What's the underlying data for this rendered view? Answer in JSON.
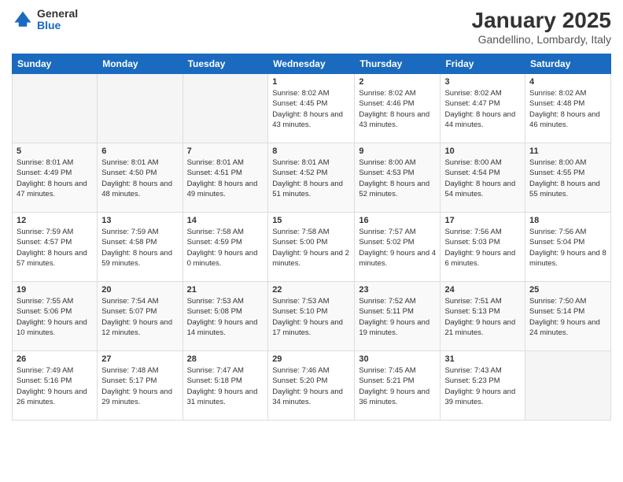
{
  "header": {
    "logo_general": "General",
    "logo_blue": "Blue",
    "month_title": "January 2025",
    "location": "Gandellino, Lombardy, Italy"
  },
  "days_of_week": [
    "Sunday",
    "Monday",
    "Tuesday",
    "Wednesday",
    "Thursday",
    "Friday",
    "Saturday"
  ],
  "weeks": [
    [
      {
        "day": "",
        "info": ""
      },
      {
        "day": "",
        "info": ""
      },
      {
        "day": "",
        "info": ""
      },
      {
        "day": "1",
        "info": "Sunrise: 8:02 AM\nSunset: 4:45 PM\nDaylight: 8 hours and 43 minutes."
      },
      {
        "day": "2",
        "info": "Sunrise: 8:02 AM\nSunset: 4:46 PM\nDaylight: 8 hours and 43 minutes."
      },
      {
        "day": "3",
        "info": "Sunrise: 8:02 AM\nSunset: 4:47 PM\nDaylight: 8 hours and 44 minutes."
      },
      {
        "day": "4",
        "info": "Sunrise: 8:02 AM\nSunset: 4:48 PM\nDaylight: 8 hours and 46 minutes."
      }
    ],
    [
      {
        "day": "5",
        "info": "Sunrise: 8:01 AM\nSunset: 4:49 PM\nDaylight: 8 hours and 47 minutes."
      },
      {
        "day": "6",
        "info": "Sunrise: 8:01 AM\nSunset: 4:50 PM\nDaylight: 8 hours and 48 minutes."
      },
      {
        "day": "7",
        "info": "Sunrise: 8:01 AM\nSunset: 4:51 PM\nDaylight: 8 hours and 49 minutes."
      },
      {
        "day": "8",
        "info": "Sunrise: 8:01 AM\nSunset: 4:52 PM\nDaylight: 8 hours and 51 minutes."
      },
      {
        "day": "9",
        "info": "Sunrise: 8:00 AM\nSunset: 4:53 PM\nDaylight: 8 hours and 52 minutes."
      },
      {
        "day": "10",
        "info": "Sunrise: 8:00 AM\nSunset: 4:54 PM\nDaylight: 8 hours and 54 minutes."
      },
      {
        "day": "11",
        "info": "Sunrise: 8:00 AM\nSunset: 4:55 PM\nDaylight: 8 hours and 55 minutes."
      }
    ],
    [
      {
        "day": "12",
        "info": "Sunrise: 7:59 AM\nSunset: 4:57 PM\nDaylight: 8 hours and 57 minutes."
      },
      {
        "day": "13",
        "info": "Sunrise: 7:59 AM\nSunset: 4:58 PM\nDaylight: 8 hours and 59 minutes."
      },
      {
        "day": "14",
        "info": "Sunrise: 7:58 AM\nSunset: 4:59 PM\nDaylight: 9 hours and 0 minutes."
      },
      {
        "day": "15",
        "info": "Sunrise: 7:58 AM\nSunset: 5:00 PM\nDaylight: 9 hours and 2 minutes."
      },
      {
        "day": "16",
        "info": "Sunrise: 7:57 AM\nSunset: 5:02 PM\nDaylight: 9 hours and 4 minutes."
      },
      {
        "day": "17",
        "info": "Sunrise: 7:56 AM\nSunset: 5:03 PM\nDaylight: 9 hours and 6 minutes."
      },
      {
        "day": "18",
        "info": "Sunrise: 7:56 AM\nSunset: 5:04 PM\nDaylight: 9 hours and 8 minutes."
      }
    ],
    [
      {
        "day": "19",
        "info": "Sunrise: 7:55 AM\nSunset: 5:06 PM\nDaylight: 9 hours and 10 minutes."
      },
      {
        "day": "20",
        "info": "Sunrise: 7:54 AM\nSunset: 5:07 PM\nDaylight: 9 hours and 12 minutes."
      },
      {
        "day": "21",
        "info": "Sunrise: 7:53 AM\nSunset: 5:08 PM\nDaylight: 9 hours and 14 minutes."
      },
      {
        "day": "22",
        "info": "Sunrise: 7:53 AM\nSunset: 5:10 PM\nDaylight: 9 hours and 17 minutes."
      },
      {
        "day": "23",
        "info": "Sunrise: 7:52 AM\nSunset: 5:11 PM\nDaylight: 9 hours and 19 minutes."
      },
      {
        "day": "24",
        "info": "Sunrise: 7:51 AM\nSunset: 5:13 PM\nDaylight: 9 hours and 21 minutes."
      },
      {
        "day": "25",
        "info": "Sunrise: 7:50 AM\nSunset: 5:14 PM\nDaylight: 9 hours and 24 minutes."
      }
    ],
    [
      {
        "day": "26",
        "info": "Sunrise: 7:49 AM\nSunset: 5:16 PM\nDaylight: 9 hours and 26 minutes."
      },
      {
        "day": "27",
        "info": "Sunrise: 7:48 AM\nSunset: 5:17 PM\nDaylight: 9 hours and 29 minutes."
      },
      {
        "day": "28",
        "info": "Sunrise: 7:47 AM\nSunset: 5:18 PM\nDaylight: 9 hours and 31 minutes."
      },
      {
        "day": "29",
        "info": "Sunrise: 7:46 AM\nSunset: 5:20 PM\nDaylight: 9 hours and 34 minutes."
      },
      {
        "day": "30",
        "info": "Sunrise: 7:45 AM\nSunset: 5:21 PM\nDaylight: 9 hours and 36 minutes."
      },
      {
        "day": "31",
        "info": "Sunrise: 7:43 AM\nSunset: 5:23 PM\nDaylight: 9 hours and 39 minutes."
      },
      {
        "day": "",
        "info": ""
      }
    ]
  ]
}
